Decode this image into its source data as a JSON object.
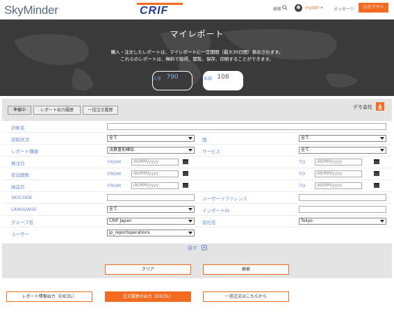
{
  "header": {
    "brand_logo": "SkyMinder",
    "crif_logo": "CRIF",
    "search_label": "検索",
    "user_label": "mySKY",
    "messages_label": "メッセージ",
    "logout_label": "ログアウト"
  },
  "hero": {
    "title": "マイレポート",
    "desc_line1": "購入・注文したレポートは、マイレポートに一定期間（最大30日間）表示されます。",
    "desc_line2": "これらのレポートは、無料で取得、閲覧、保存、印刷することができます。",
    "stats": [
      {
        "number": "790",
        "label": "文書"
      },
      {
        "number": "108",
        "label": "未読"
      }
    ]
  },
  "tabs": [
    {
      "label": "準備中"
    },
    {
      "label": "レポート出力履歴"
    },
    {
      "label": "一括注文履歴"
    }
  ],
  "company": "デモ会社",
  "filters": {
    "subject_name": {
      "label": "対象名",
      "value": ""
    },
    "read_status": {
      "label": "読取状況",
      "value": "全て"
    },
    "country": {
      "label": "国",
      "value": "全て"
    },
    "report_type": {
      "label": "レポート種類",
      "value": "決算書前確認"
    },
    "service": {
      "label": "サービス",
      "value": "全て"
    },
    "order_date": {
      "label": "発注日"
    },
    "expiry_date": {
      "label": "有効期限"
    },
    "delivery_date": {
      "label": "納品日"
    },
    "from_label": "FROM",
    "to_label": "TO",
    "date_placeholder": "dd/MM/yyyy",
    "skycode": {
      "label": "SKYCODE",
      "value": ""
    },
    "user_reference": {
      "label": "ユーザーリファレンス",
      "value": ""
    },
    "language": {
      "label": "LANGUAGE",
      "value": "全て"
    },
    "import_id": {
      "label": "インポートID",
      "value": ""
    },
    "group_name": {
      "label": "グループ名",
      "value": "CRIF Japan"
    },
    "company_name": {
      "label": "会社名",
      "value": "Tokyo"
    },
    "user": {
      "label": "ユーザー",
      "value": "jp_reportoperations"
    }
  },
  "hide_label": "隠す",
  "buttons": {
    "clear": "クリア",
    "search": "検索",
    "export_report_info": "レポート情報出力（EXCEL）",
    "export_order_history": "注文履歴の出力（EXCEL）",
    "bulk_order": "一括注文はこちらから"
  },
  "colors": {
    "accent": "#f26b21",
    "label_blue": "#6a8ad0",
    "hero_bg": "#3a3a3a"
  }
}
